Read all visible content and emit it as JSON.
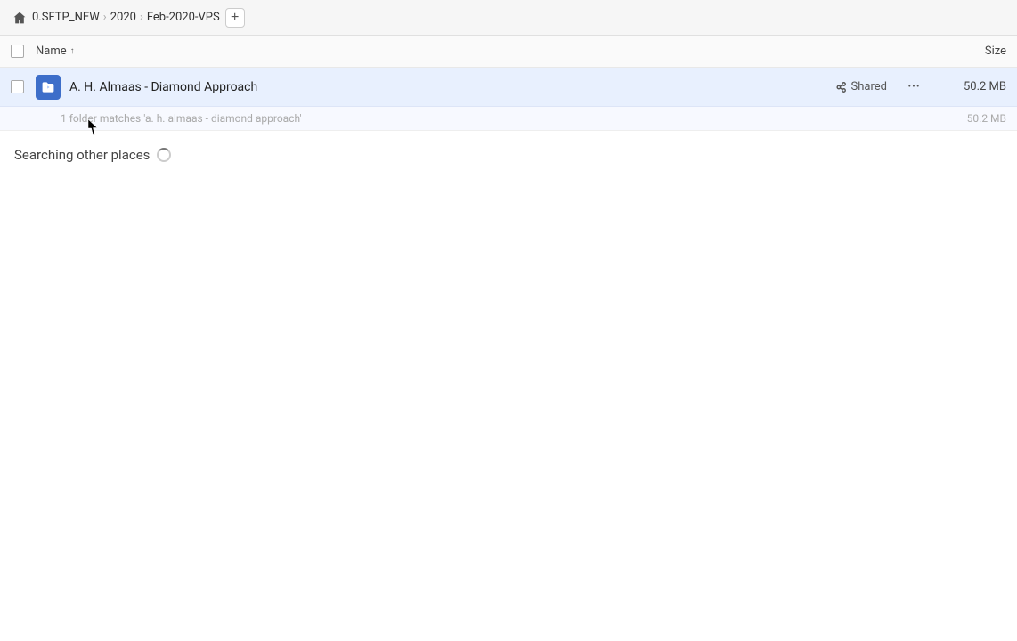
{
  "header": {
    "home_icon": "🏠",
    "breadcrumb": [
      {
        "label": "0.SFTP_NEW"
      },
      {
        "label": "2020"
      },
      {
        "label": "Feb-2020-VPS"
      }
    ],
    "add_button_label": "+"
  },
  "columns": {
    "name_label": "Name",
    "size_label": "Size",
    "sort_arrow": "↑"
  },
  "file_row": {
    "name": "A. H. Almaas - Diamond Approach",
    "shared_label": "Shared",
    "more_icon": "···",
    "size": "50.2 MB"
  },
  "match_info": {
    "text": "1 folder matches 'a. h. almaas - diamond approach'",
    "size": "50.2 MB"
  },
  "searching_section": {
    "label": "Searching other places"
  }
}
